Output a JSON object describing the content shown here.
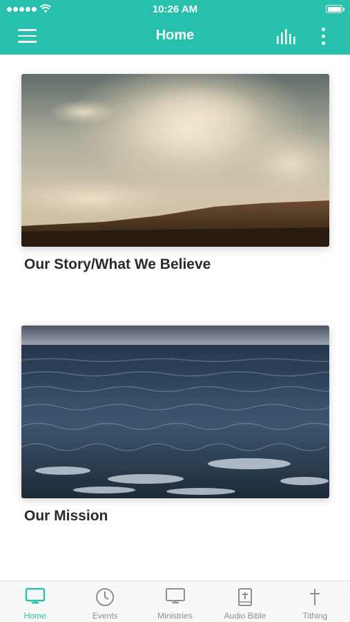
{
  "status_bar": {
    "time": "10:26 AM"
  },
  "header": {
    "title": "Home"
  },
  "cards": [
    {
      "title": "Our Story/What We Believe",
      "image": "desert-sky-image"
    },
    {
      "title": "Our Mission",
      "image": "ocean-water-image"
    }
  ],
  "tabs": [
    {
      "label": "Home",
      "icon": "monitor-icon",
      "active": true
    },
    {
      "label": "Events",
      "icon": "clock-icon",
      "active": false
    },
    {
      "label": "Ministries",
      "icon": "monitor-icon",
      "active": false
    },
    {
      "label": "Audio Bible",
      "icon": "bible-icon",
      "active": false
    },
    {
      "label": "Tithing",
      "icon": "cross-icon",
      "active": false
    }
  ],
  "colors": {
    "accent": "#26c0ad",
    "inactive": "#8e8e8e"
  }
}
